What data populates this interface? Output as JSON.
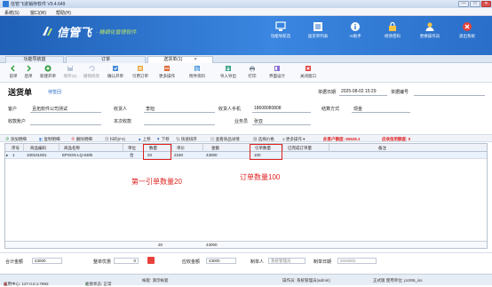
{
  "window": {
    "title": "信管飞进销存软件 V9.4.649",
    "minimize": "—",
    "maximize": "□",
    "close": "✕"
  },
  "menu": [
    "系统(S)",
    "窗口(W)",
    "帮助(H)"
  ],
  "banner": {
    "logo_text": "信管飞",
    "logo_sub": "· 精细化管理软件",
    "buttons": [
      {
        "label": "功能导航首",
        "icon": "monitor-icon"
      },
      {
        "label": "送货单列表",
        "icon": "list-icon"
      },
      {
        "label": "AI助手",
        "icon": "info-icon"
      },
      {
        "label": "修改密码",
        "icon": "lock-icon"
      },
      {
        "label": "更换操作员",
        "icon": "user-icon"
      },
      {
        "label": "退出系统",
        "icon": "exit-icon"
      }
    ]
  },
  "tabs": [
    {
      "label": "功能导航首"
    },
    {
      "label": "订单"
    },
    {
      "label": "送货单(1)",
      "close": "×"
    }
  ],
  "toolbar": [
    {
      "label": "前单",
      "icon": "arrow-left-icon",
      "enabled": true
    },
    {
      "label": "后单",
      "icon": "arrow-right-icon",
      "enabled": true
    },
    {
      "label": "新建开单",
      "icon": "add-doc-icon",
      "enabled": true
    },
    {
      "label": "保存(S)",
      "icon": "save-icon",
      "enabled": false
    },
    {
      "label": "撤销修改",
      "icon": "undo-icon",
      "enabled": false
    },
    {
      "label": "确认开单",
      "icon": "confirm-icon",
      "enabled": true
    },
    {
      "label": "引用订单",
      "icon": "reference-icon",
      "enabled": true
    },
    {
      "label": "更多操作",
      "icon": "more-icon",
      "enabled": true
    },
    {
      "label": "附件资料",
      "icon": "attachment-icon",
      "enabled": true
    },
    {
      "label": "导入导出",
      "icon": "import-export-icon",
      "enabled": true
    },
    {
      "label": "打印",
      "icon": "print-icon",
      "enabled": true
    },
    {
      "label": "界面设计",
      "icon": "design-icon",
      "enabled": true
    },
    {
      "label": "关闭窗口",
      "icon": "close-window-icon",
      "enabled": true
    }
  ],
  "form": {
    "doc_title": "送货单",
    "status": "待签回",
    "date_label": "单据日期",
    "date_value": "2025-08-02 15:29",
    "docno_label": "单据编号",
    "customer_label": "客户",
    "customer_value": "且拓软件公司测试",
    "receiver_label": "收货人",
    "receiver_value": "李旭",
    "phone_label": "收货人手机",
    "phone_value": "18608080808",
    "settle_label": "结算方式",
    "settle_value": "现金",
    "account_label": "收款账户",
    "received_label": "本次收款",
    "sales_label": "业务员",
    "sales_value": "张亚"
  },
  "detail_toolbar": {
    "items": [
      "添加明细",
      "复制明细",
      "删除明细",
      "扫码(F4)",
      "上移",
      "下移",
      "快速排序",
      "查看商品详情",
      "选择价格",
      "更多操作"
    ],
    "credit_label": "此客户额度:",
    "credit_value": "50628.1",
    "receivable_label": "应收信用额度:",
    "receivable_value": "0"
  },
  "grid": {
    "headers": [
      "序号",
      "商品编码",
      "商品名称",
      "单位",
      "数量",
      "单价",
      "金额",
      "引单数量",
      "已完成订单量",
      "备注"
    ],
    "rows": [
      {
        "no": "1",
        "code": "100101001",
        "name": "EPSON LQ-630k",
        "unit": "台",
        "qty": "20",
        "price": "2150",
        "amount": "43000",
        "ref_qty": "100",
        "done_qty": "",
        "note": ""
      }
    ],
    "sum_qty": "20",
    "sum_amount": "43000"
  },
  "annotations": {
    "left": "第一引单数量20",
    "right": "订单数量100"
  },
  "footer": {
    "total_label": "合计金额",
    "total_value": "43000",
    "discount_label": "整单优惠",
    "discount_value": "0",
    "due_label": "应收金额",
    "due_value": "43000",
    "maker_label": "制单人",
    "maker_value": "系统管理员",
    "made_date_label": "制单日期",
    "made_date_value": "2025/8/2"
  },
  "statusbar": {
    "app_center": "应用中心: 127.0.0.1:7893",
    "connection": "连接状态: 正常",
    "storefront": "帐套: 演示帐套",
    "operator": "操作员: 系统管理员(admin)",
    "version": "正式版 使用单位: pc006_iss"
  },
  "colors": {
    "banner": "#2a6fc9",
    "accent_red": "#e02020",
    "status_text": "#2a6fc9"
  }
}
